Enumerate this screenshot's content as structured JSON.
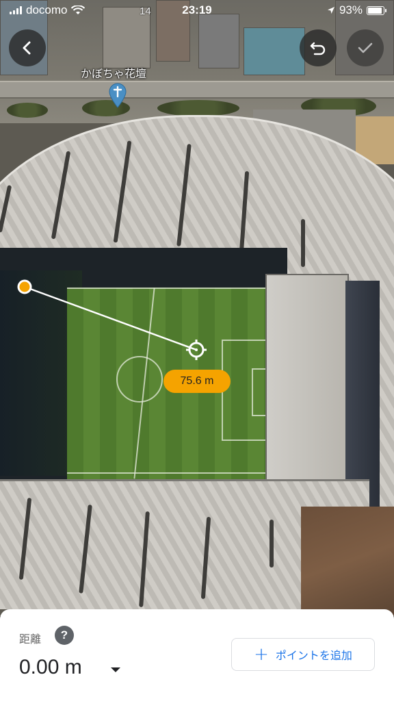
{
  "status_bar": {
    "carrier": "docomo",
    "time": "23:19",
    "battery": "93%",
    "battery_level": 0.93
  },
  "map": {
    "place_label": "かぼちゃ花壇",
    "street_number": "14"
  },
  "toolbar": {
    "back_icon": "chevron-left-icon",
    "undo_icon": "undo-icon",
    "done_icon": "check-icon"
  },
  "measurement": {
    "segment_distance": "75.6 m",
    "accent_color": "#f5a300"
  },
  "sheet": {
    "label": "距離",
    "help": "?",
    "total_distance": "0.00 m",
    "add_point_label": "ポイントを追加",
    "add_point_color": "#1a73e8"
  }
}
